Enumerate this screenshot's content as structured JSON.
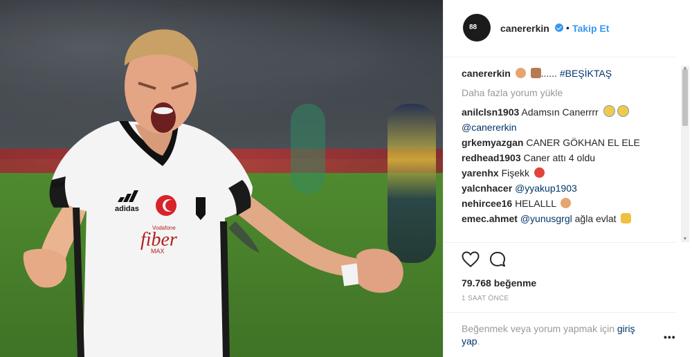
{
  "post": {
    "username": "canererkin",
    "follow_label": "Takip Et",
    "separator": "•"
  },
  "caption": {
    "username": "canererkin",
    "text_suffix": "......",
    "hashtag": "#BEŞİKTAŞ"
  },
  "load_more": "Daha fazla yorum yükle",
  "comments": [
    {
      "user": "anilclsn1903",
      "text": "Adamsın Canerrrr",
      "mention": "@canererkin"
    },
    {
      "user": "grkemyazgan",
      "text": "CANER GÖKHAN EL ELE"
    },
    {
      "user": "redhead1903",
      "text": "Caner attı 4 oldu"
    },
    {
      "user": "yarenhx",
      "text": "Fişekk"
    },
    {
      "user": "yalcnhacer",
      "mention": "@yyakup1903"
    },
    {
      "user": "nehircee16",
      "text": "HELALLL"
    },
    {
      "user": "emec.ahmet",
      "mention": "@yunusgrgl",
      "text": "ağla evlat"
    }
  ],
  "likes": "79.768 beğenme",
  "time": "1 SAAT ÖNCE",
  "login": {
    "prefix": "Beğenmek veya yorum yapmak için",
    "link": "giriş yap",
    "suffix": "."
  },
  "options_label": "•••",
  "avatar_number": "88",
  "photo_texts": {
    "brand": "adidas",
    "sponsor": "Vodafone",
    "chest": "fiber",
    "chest_sub": "MAX"
  },
  "colors": {
    "link": "#003569",
    "accent": "#3897f0",
    "muted": "#999999"
  }
}
